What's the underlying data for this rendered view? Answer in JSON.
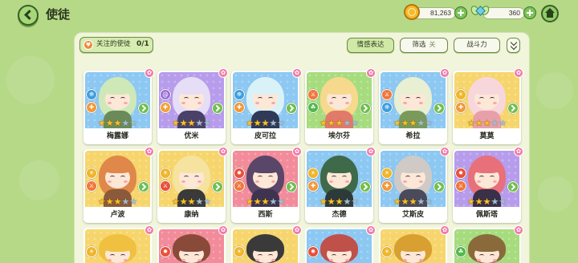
{
  "header": {
    "title": "使徒",
    "back_icon": "back-arrow-icon",
    "home_icon": "home-icon"
  },
  "currency": {
    "coins": {
      "icon": "coin-icon",
      "value": "81,263"
    },
    "gems": {
      "icon": "winged-gem-icon",
      "value": "360"
    }
  },
  "favorites": {
    "icon": "heart-icon",
    "label": "关注的使徒",
    "count": "0/1"
  },
  "toolbar": {
    "emotion": "情感表达",
    "filter": "筛选",
    "filter_state": "关",
    "power": "战斗力",
    "sort_icon": "double-chevron-down-icon"
  },
  "colors": {
    "background": "#b6d987",
    "panel": "#f1f5dc",
    "accent": "#7cc459",
    "badge": "#f27aa8"
  },
  "stars_total": 5,
  "cards": [
    {
      "name": "梅露娜",
      "bg": "#8cc8f2",
      "hair": "#cfe8b8",
      "outfit": "#6b8a5a",
      "stars": 3,
      "icons": [
        {
          "name": "snowflake-icon",
          "color": "#3f9fe0"
        },
        {
          "name": "cross-icon",
          "color": "#f2993a"
        }
      ]
    },
    {
      "name": "优米",
      "bg": "#b79cec",
      "hair": "#e6def6",
      "outfit": "#4a4168",
      "stars": 3,
      "icons": [
        {
          "name": "swirl-icon",
          "color": "#9a6ad8"
        },
        {
          "name": "cross-icon",
          "color": "#f2a33a"
        }
      ]
    },
    {
      "name": "皮可拉",
      "bg": "#8cc8f2",
      "hair": "#d9f2f8",
      "outfit": "#2e3a58",
      "stars": 3,
      "icons": [
        {
          "name": "snowflake-icon",
          "color": "#3f9fe0"
        },
        {
          "name": "cross-icon",
          "color": "#f2993a"
        }
      ]
    },
    {
      "name": "埃尔芬",
      "bg": "#a6dc7e",
      "hair": "#f6d98c",
      "outfit": "#e27a6a",
      "stars": 3,
      "icons": [
        {
          "name": "sword-icon",
          "color": "#f0773a"
        },
        {
          "name": "leaf-icon",
          "color": "#54b84a"
        }
      ]
    },
    {
      "name": "希拉",
      "bg": "#8cc8f2",
      "hair": "#e8efd2",
      "outfit": "#7a9a5c",
      "stars": 3,
      "icons": [
        {
          "name": "sword-icon",
          "color": "#f0773a"
        },
        {
          "name": "snowflake-icon",
          "color": "#3f9fe0"
        }
      ]
    },
    {
      "name": "莫莫",
      "bg": "#f6d66c",
      "hair": "#f7d6dc",
      "outfit": "#e8a0a8",
      "stars": 3,
      "icons": [
        {
          "name": "sun-icon",
          "color": "#f0b52a"
        },
        {
          "name": "cross-icon",
          "color": "#f2993a"
        }
      ]
    },
    {
      "name": "卢波",
      "bg": "#f6d66c",
      "hair": "#e0874a",
      "outfit": "#8a5a3a",
      "stars": 3,
      "icons": [
        {
          "name": "sun-icon",
          "color": "#f0b52a"
        },
        {
          "name": "sword-icon",
          "color": "#f0773a"
        }
      ]
    },
    {
      "name": "康纳",
      "bg": "#f6d66c",
      "hair": "#f6e3a0",
      "outfit": "#3a3a3a",
      "stars": 3,
      "icons": [
        {
          "name": "sun-icon",
          "color": "#f0b52a"
        },
        {
          "name": "sword-icon",
          "color": "#e8503a"
        }
      ]
    },
    {
      "name": "西斯",
      "bg": "#f28b9a",
      "hair": "#5a4668",
      "outfit": "#3e3450",
      "stars": 3,
      "icons": [
        {
          "name": "flame-icon",
          "color": "#e8503a"
        },
        {
          "name": "sword-icon",
          "color": "#f0773a"
        }
      ]
    },
    {
      "name": "杰德",
      "bg": "#8cc8f2",
      "hair": "#3e6a4a",
      "outfit": "#2e3a3a",
      "stars": 3,
      "icons": [
        {
          "name": "sun-icon",
          "color": "#f0b52a"
        },
        {
          "name": "cross-icon",
          "color": "#f2993a"
        }
      ]
    },
    {
      "name": "艾斯皮",
      "bg": "#8cc8f2",
      "hair": "#cfcac6",
      "outfit": "#4a4a5a",
      "stars": 3,
      "icons": [
        {
          "name": "sun-icon",
          "color": "#f0b52a"
        },
        {
          "name": "cross-icon",
          "color": "#f2993a"
        }
      ]
    },
    {
      "name": "佩斯塔",
      "bg": "#b79cec",
      "hair": "#e8707a",
      "outfit": "#3a3048",
      "stars": 3,
      "icons": [
        {
          "name": "flame-icon",
          "color": "#e8503a"
        },
        {
          "name": "sword-icon",
          "color": "#f0773a"
        }
      ]
    },
    {
      "bg": "#f6d66c",
      "hair": "#f0c040",
      "outfit": "#6a4a2a",
      "icons": [
        {
          "name": "sun-icon",
          "color": "#f0b52a"
        }
      ]
    },
    {
      "bg": "#f28b9a",
      "hair": "#8a4a3a",
      "outfit": "#5a3a3a",
      "icons": [
        {
          "name": "flame-icon",
          "color": "#e8503a"
        }
      ]
    },
    {
      "bg": "#f6d66c",
      "hair": "#3a3a3a",
      "outfit": "#3a3a3a",
      "icons": [
        {
          "name": "sun-icon",
          "color": "#f0b52a"
        }
      ]
    },
    {
      "bg": "#8cc8f2",
      "hair": "#c0504a",
      "outfit": "#4a4a4a",
      "icons": [
        {
          "name": "flame-icon",
          "color": "#e8503a"
        }
      ]
    },
    {
      "bg": "#f6d66c",
      "hair": "#d8a030",
      "outfit": "#8a6a3a",
      "icons": [
        {
          "name": "sun-icon",
          "color": "#f0b52a"
        }
      ]
    },
    {
      "bg": "#a6dc7e",
      "hair": "#8a6a3a",
      "outfit": "#5a7a3a",
      "icons": [
        {
          "name": "leaf-icon",
          "color": "#54b84a"
        }
      ]
    }
  ]
}
